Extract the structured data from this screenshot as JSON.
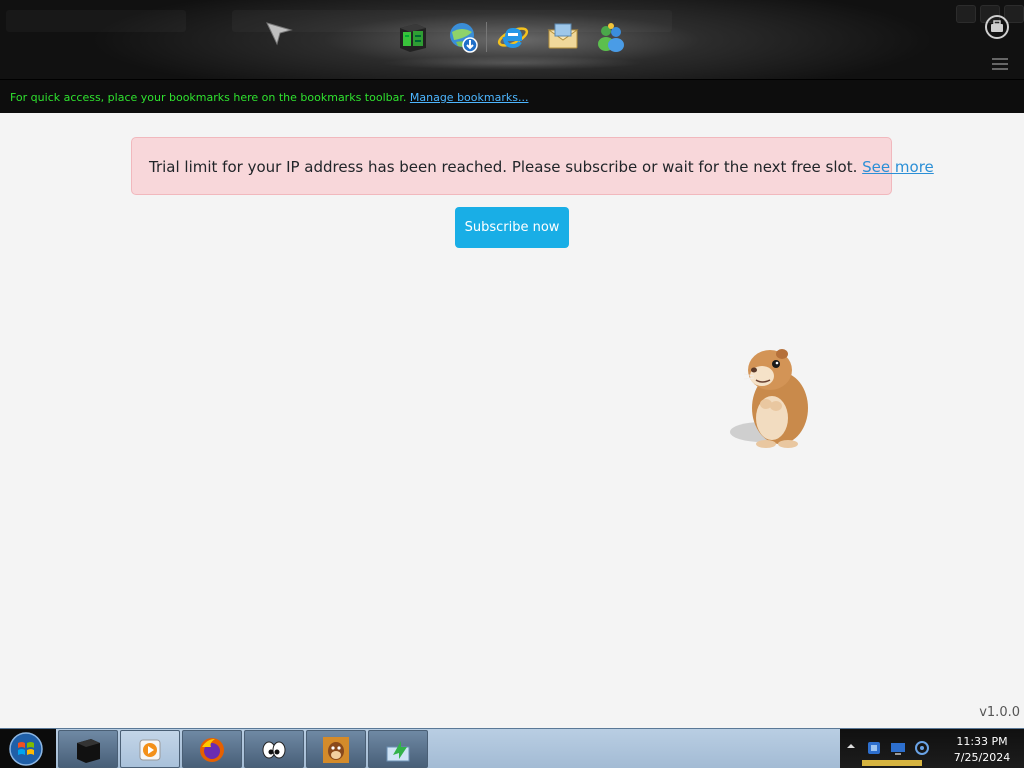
{
  "topbar": {
    "icons": [
      "pointer-icon",
      "task-manager-icon",
      "ie-download-icon",
      "internet-explorer-icon",
      "mail-icon",
      "messenger-icon"
    ]
  },
  "bookmarks_bar": {
    "message": "For quick access, place your bookmarks here on the bookmarks toolbar.",
    "manage_link": "Manage bookmarks..."
  },
  "alert": {
    "message": "Trial limit for your IP address has been reached. Please subscribe or wait for the next free slot.",
    "link_text": "See more"
  },
  "subscribe_button": {
    "label": "Subscribe now"
  },
  "version": "v1.0.0",
  "taskbar": {
    "buttons": [
      "black-box-app-icon",
      "media-player-icon",
      "firefox-icon",
      "cartoon-eyes-icon",
      "dog-app-icon",
      "green-arrow-app-icon"
    ],
    "clock": {
      "time": "11:33 PM",
      "date": "7/25/2024"
    }
  },
  "colors": {
    "alert_bg": "#f8d7da",
    "button_bg": "#19aee6",
    "link": "#2b8fd6",
    "bookmark_text": "#2fe22f"
  }
}
